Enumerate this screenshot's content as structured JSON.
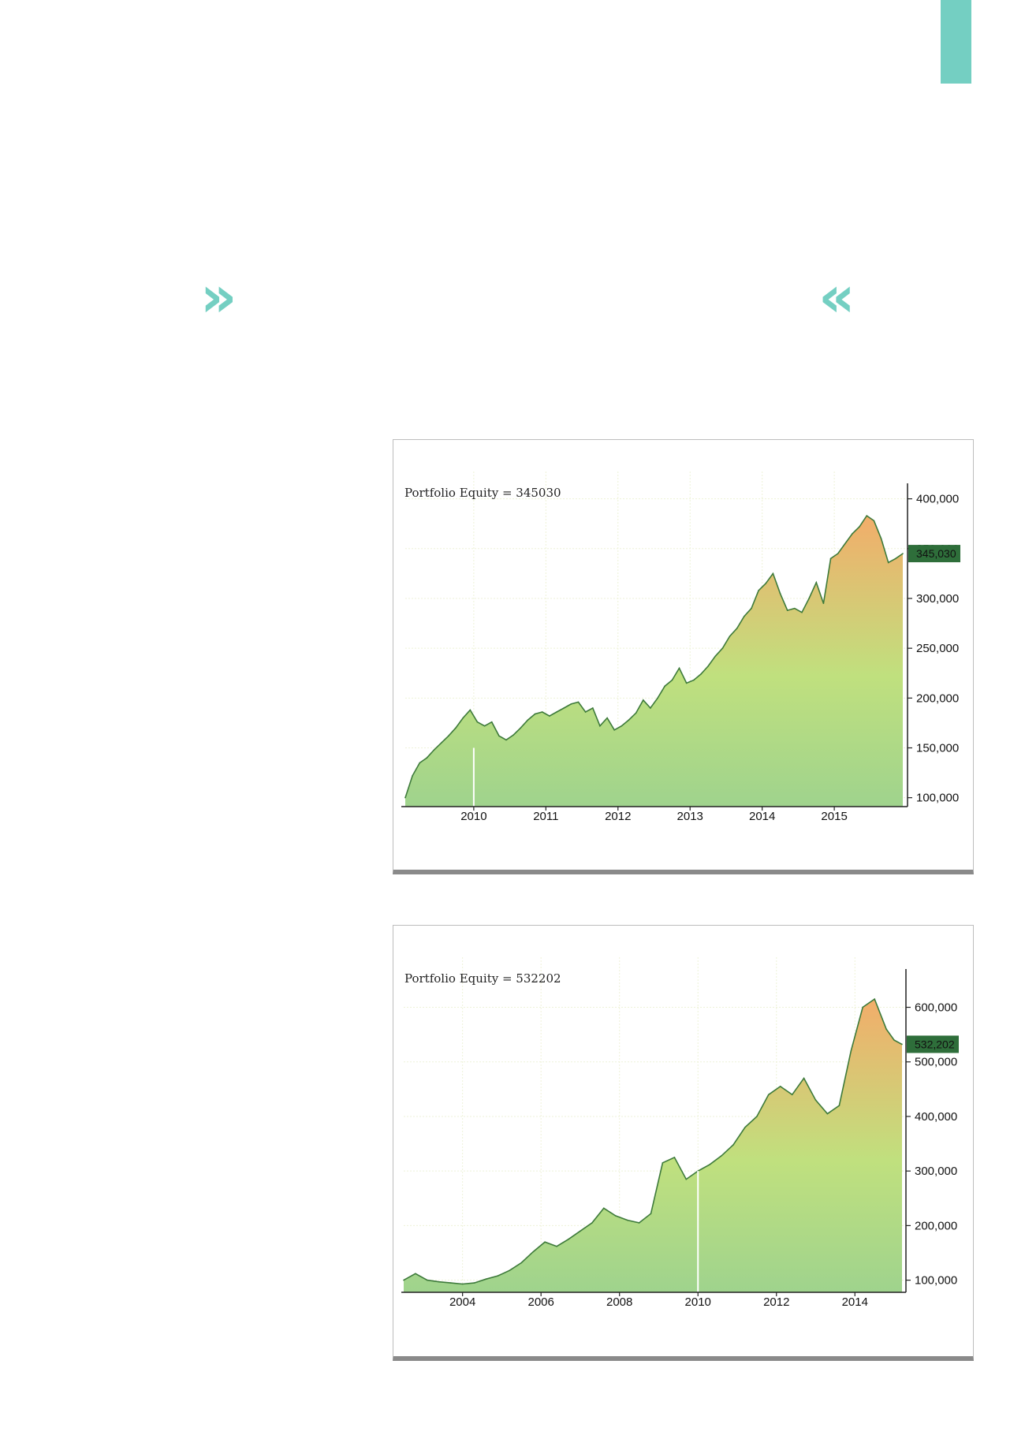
{
  "decor": {
    "quote_open": "»",
    "quote_close": "«",
    "accent_color": "#74cfc2"
  },
  "chart_data": [
    {
      "type": "area",
      "title": "Portfolio Equity = 345030",
      "last_value_label": "345,030",
      "xlabel": "",
      "ylabel": "",
      "ylim": [
        95000,
        410000
      ],
      "xlim": [
        2009.05,
        2015.95
      ],
      "x_tick_labels": [
        "2010",
        "2011",
        "2012",
        "2013",
        "2014",
        "2015"
      ],
      "x_tick_values": [
        2010,
        2011,
        2012,
        2013,
        2014,
        2015
      ],
      "y_tick_labels": [
        "400,000",
        "350,000",
        "300,000",
        "250,000",
        "200,000",
        "150,000",
        "100,000"
      ],
      "y_tick_values": [
        400000,
        350000,
        300000,
        250000,
        200000,
        150000,
        100000
      ],
      "grid": true,
      "colors": {
        "line": "#3d7a3a",
        "fill_low": "#9fd38d",
        "fill_mid": "#c0e07e",
        "fill_high": "#f2ad6a",
        "label_bg": "#2e6e3a"
      },
      "x": [
        2009.05,
        2009.15,
        2009.25,
        2009.35,
        2009.45,
        2009.55,
        2009.65,
        2009.75,
        2009.85,
        2009.95,
        2010.05,
        2010.15,
        2010.25,
        2010.35,
        2010.45,
        2010.55,
        2010.65,
        2010.75,
        2010.85,
        2010.95,
        2011.05,
        2011.15,
        2011.25,
        2011.35,
        2011.45,
        2011.55,
        2011.65,
        2011.75,
        2011.85,
        2011.95,
        2012.05,
        2012.15,
        2012.25,
        2012.35,
        2012.45,
        2012.55,
        2012.65,
        2012.75,
        2012.85,
        2012.95,
        2013.05,
        2013.15,
        2013.25,
        2013.35,
        2013.45,
        2013.55,
        2013.65,
        2013.75,
        2013.85,
        2013.95,
        2014.05,
        2014.15,
        2014.25,
        2014.35,
        2014.45,
        2014.55,
        2014.65,
        2014.75,
        2014.85,
        2014.95,
        2015.05,
        2015.15,
        2015.25,
        2015.35,
        2015.45,
        2015.55,
        2015.65,
        2015.75,
        2015.85,
        2015.95
      ],
      "y": [
        100000,
        122000,
        135000,
        140000,
        148000,
        155000,
        162000,
        170000,
        180000,
        188000,
        176000,
        172000,
        176000,
        162000,
        158000,
        163000,
        170000,
        178000,
        184000,
        186000,
        182000,
        186000,
        190000,
        194000,
        196000,
        186000,
        190000,
        172000,
        180000,
        168000,
        172000,
        178000,
        185000,
        198000,
        190000,
        200000,
        212000,
        218000,
        230000,
        215000,
        218000,
        224000,
        232000,
        242000,
        250000,
        262000,
        270000,
        282000,
        290000,
        308000,
        315000,
        325000,
        305000,
        288000,
        290000,
        286000,
        300000,
        316000,
        295000,
        340000,
        345000,
        355000,
        365000,
        372000,
        383000,
        378000,
        360000,
        336000,
        340000,
        345030
      ]
    },
    {
      "type": "area",
      "title": "Portfolio Equity = 532202",
      "last_value_label": "532,202",
      "xlabel": "",
      "ylabel": "",
      "ylim": [
        85000,
        660000
      ],
      "xlim": [
        2002.5,
        2015.2
      ],
      "x_tick_labels": [
        "2004",
        "2006",
        "2008",
        "2010",
        "2012",
        "2014"
      ],
      "x_tick_values": [
        2004,
        2006,
        2008,
        2010,
        2012,
        2014
      ],
      "y_tick_labels": [
        "600,000",
        "500,000",
        "400,000",
        "300,000",
        "200,000",
        "100,000"
      ],
      "y_tick_values": [
        600000,
        500000,
        400000,
        300000,
        200000,
        100000
      ],
      "grid": true,
      "colors": {
        "line": "#3d7a3a",
        "fill_low": "#9fd38d",
        "fill_mid": "#c0e07e",
        "fill_high": "#f2ad6a",
        "label_bg": "#2e6e3a"
      },
      "x": [
        2002.5,
        2002.8,
        2003.1,
        2003.4,
        2003.7,
        2004.0,
        2004.3,
        2004.6,
        2004.9,
        2005.2,
        2005.5,
        2005.8,
        2006.1,
        2006.4,
        2006.7,
        2007.0,
        2007.3,
        2007.6,
        2007.9,
        2008.2,
        2008.5,
        2008.8,
        2009.1,
        2009.4,
        2009.7,
        2010.0,
        2010.3,
        2010.6,
        2010.9,
        2011.2,
        2011.5,
        2011.8,
        2012.1,
        2012.4,
        2012.7,
        2013.0,
        2013.3,
        2013.6,
        2013.9,
        2014.2,
        2014.5,
        2014.8,
        2015.0,
        2015.2
      ],
      "y": [
        100000,
        112000,
        100000,
        97000,
        95000,
        93000,
        95000,
        102000,
        108000,
        118000,
        132000,
        152000,
        170000,
        162000,
        175000,
        190000,
        205000,
        232000,
        218000,
        210000,
        205000,
        222000,
        315000,
        325000,
        285000,
        300000,
        312000,
        328000,
        348000,
        380000,
        400000,
        440000,
        455000,
        440000,
        470000,
        430000,
        405000,
        420000,
        520000,
        600000,
        615000,
        560000,
        540000,
        532202
      ]
    }
  ]
}
